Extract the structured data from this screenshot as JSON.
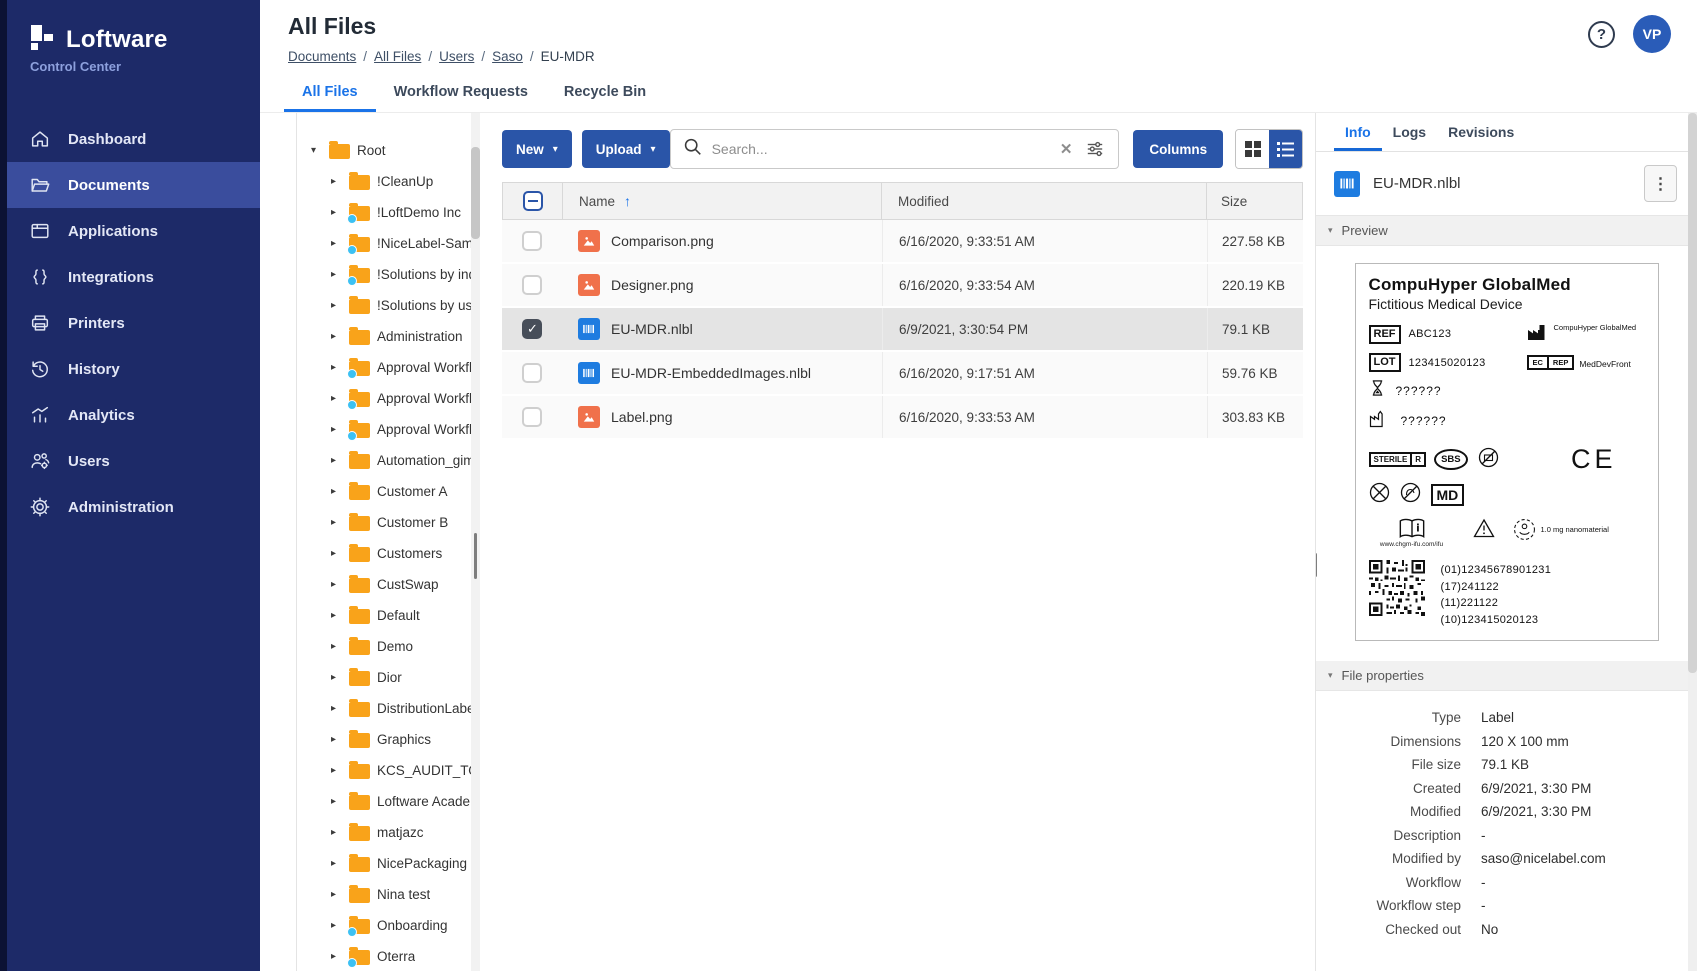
{
  "brand": {
    "name": "Loftware",
    "product": "Control Center"
  },
  "sidebar": {
    "items": [
      {
        "label": "Dashboard"
      },
      {
        "label": "Documents",
        "active": true
      },
      {
        "label": "Applications"
      },
      {
        "label": "Integrations"
      },
      {
        "label": "Printers"
      },
      {
        "label": "History"
      },
      {
        "label": "Analytics"
      },
      {
        "label": "Users"
      },
      {
        "label": "Administration"
      }
    ]
  },
  "header": {
    "title": "All Files",
    "help_icon": "?",
    "avatar_initials": "VP"
  },
  "breadcrumb": [
    {
      "label": "Documents"
    },
    {
      "label": "All Files"
    },
    {
      "label": "Users"
    },
    {
      "label": "Saso"
    },
    {
      "label": "EU-MDR",
      "current": true
    }
  ],
  "tabs": [
    {
      "label": "All Files",
      "active": true
    },
    {
      "label": "Workflow Requests"
    },
    {
      "label": "Recycle Bin"
    }
  ],
  "tree": {
    "items": [
      {
        "label": "Root",
        "expanded": true
      },
      {
        "label": "!CleanUp"
      },
      {
        "label": "!LoftDemo Inc",
        "dot": true
      },
      {
        "label": "!NiceLabel-Samples",
        "dot": true
      },
      {
        "label": "!Solutions by indu...",
        "dot": true
      },
      {
        "label": "!Solutions by use ..."
      },
      {
        "label": "Administration"
      },
      {
        "label": "Approval Workflo...",
        "dot": true
      },
      {
        "label": "Approval Workflo...",
        "dot": true
      },
      {
        "label": "Approval Workflo...",
        "dot": true
      },
      {
        "label": "Automation_gimi..."
      },
      {
        "label": "Customer A"
      },
      {
        "label": "Customer B"
      },
      {
        "label": "Customers"
      },
      {
        "label": "CustSwap"
      },
      {
        "label": "Default"
      },
      {
        "label": "Demo"
      },
      {
        "label": "Dior"
      },
      {
        "label": "DistributionLabels"
      },
      {
        "label": "Graphics"
      },
      {
        "label": "KCS_AUDIT_TOOL..."
      },
      {
        "label": "Loftware Academy"
      },
      {
        "label": "matjazc"
      },
      {
        "label": "NicePackaging"
      },
      {
        "label": "Nina test"
      },
      {
        "label": "Onboarding",
        "dot": true
      },
      {
        "label": "Oterra",
        "dot": true
      }
    ]
  },
  "toolbar": {
    "new_label": "New",
    "upload_label": "Upload",
    "search_placeholder": "Search...",
    "columns_label": "Columns"
  },
  "icons": {
    "caret_down": "▾",
    "sort_asc": "↑",
    "clear": "✕",
    "kebab": "⋮",
    "section_caret": "▾"
  },
  "table": {
    "columns": {
      "name": "Name",
      "modified": "Modified",
      "size": "Size"
    },
    "rows": [
      {
        "name": "Comparison.png",
        "isPng": true,
        "modified": "6/16/2020, 9:33:51 AM",
        "size": "227.58 KB"
      },
      {
        "name": "Designer.png",
        "isPng": true,
        "modified": "6/16/2020, 9:33:54 AM",
        "size": "220.19 KB"
      },
      {
        "name": "EU-MDR.nlbl",
        "isNlbl": true,
        "selected": true,
        "modified": "6/9/2021, 3:30:54 PM",
        "size": "79.1 KB"
      },
      {
        "name": "EU-MDR-EmbeddedImages.nlbl",
        "isNlbl": true,
        "modified": "6/16/2020, 9:17:51 AM",
        "size": "59.76 KB"
      },
      {
        "name": "Label.png",
        "isPng": true,
        "modified": "6/16/2020, 9:33:53 AM",
        "size": "303.83 KB"
      }
    ]
  },
  "details": {
    "tabs": [
      {
        "label": "Info",
        "active": true
      },
      {
        "label": "Logs"
      },
      {
        "label": "Revisions"
      }
    ],
    "file_name": "EU-MDR.nlbl",
    "sections": {
      "preview": "Preview",
      "properties": "File properties"
    },
    "preview_label": {
      "title": "CompuHyper GlobalMed",
      "subtitle": "Fictitious Medical Device",
      "ref_symbol": "REF",
      "ref_value": "ABC123",
      "lot_symbol": "LOT",
      "lot_value": "123415020123",
      "use_by_value": "??????",
      "mfg_date_value": "??????",
      "manufacturer": "CompuHyper GlobalMed",
      "ec": "EC",
      "rep": "REP",
      "ec_rep_name": "MedDevFront",
      "sterile": "STERILE",
      "sterile_method": "R",
      "sbs": "SBS",
      "ce": "CE",
      "md": "MD",
      "ifu_url": "www.chgm-ifu.com/ifu",
      "nano_note": "1.0 mg nanomaterial",
      "gs1": [
        "(01)12345678901231",
        "(17)241122",
        "(11)221122",
        "(10)123415020123"
      ]
    },
    "properties": [
      {
        "label": "Type",
        "value": "Label"
      },
      {
        "label": "Dimensions",
        "value": "120 X 100 mm"
      },
      {
        "label": "File size",
        "value": "79.1 KB"
      },
      {
        "label": "Created",
        "value": "6/9/2021, 3:30 PM"
      },
      {
        "label": "Modified",
        "value": "6/9/2021, 3:30 PM"
      },
      {
        "label": "Description",
        "value": "-"
      },
      {
        "label": "Modified by",
        "value": "saso@nicelabel.com"
      },
      {
        "label": "Workflow",
        "value": "-"
      },
      {
        "label": "Workflow step",
        "value": "-"
      },
      {
        "label": "Checked out",
        "value": "No"
      }
    ]
  }
}
